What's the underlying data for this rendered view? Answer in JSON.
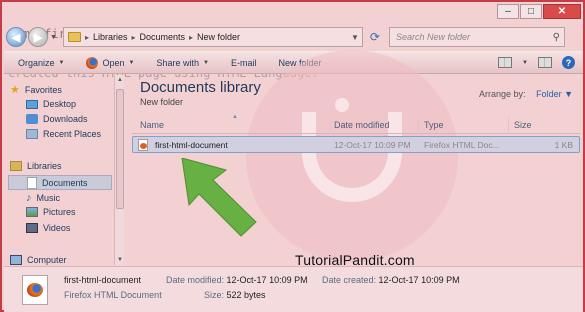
{
  "background_lines": [
    "s my first HTML document.",
    "created this HTML page using HTML Language."
  ],
  "window_controls": {
    "minimize": "–",
    "maximize": "□",
    "close": "✕"
  },
  "address": {
    "crumbs": [
      "Libraries",
      "Documents",
      "New folder"
    ],
    "separator": "▸"
  },
  "search": {
    "placeholder": "Search New folder"
  },
  "toolbar": {
    "organize": "Organize",
    "open": "Open",
    "share_with": "Share with",
    "email": "E-mail",
    "new_folder": "New folder"
  },
  "nav": {
    "favorites": "Favorites",
    "favorite_items": [
      "Desktop",
      "Downloads",
      "Recent Places"
    ],
    "libraries": "Libraries",
    "library_items": [
      "Documents",
      "Music",
      "Pictures",
      "Videos"
    ],
    "computer": "Computer"
  },
  "content": {
    "title": "Documents library",
    "subtitle": "New folder",
    "arrange_label": "Arrange by:",
    "arrange_value": "Folder",
    "columns": [
      "Name",
      "Date modified",
      "Type",
      "Size"
    ],
    "rows": [
      {
        "name": "first-html-document",
        "date_modified": "12-Oct-17 10:09 PM",
        "type": "Firefox HTML Doc...",
        "size": "1 KB"
      }
    ]
  },
  "watermark": "TutorialPandit.com",
  "details": {
    "name": "first-html-document",
    "type": "Firefox HTML Document",
    "date_modified_label": "Date modified:",
    "date_modified": "12-Oct-17 10:09 PM",
    "size_label": "Size:",
    "size": "522 bytes",
    "date_created_label": "Date created:",
    "date_created": "12-Oct-17 10:09 PM"
  },
  "colors": {
    "frame": "#c43c45",
    "window_bg": "#f3d0d2",
    "arrow": "#66b044",
    "link": "#1e395b"
  }
}
